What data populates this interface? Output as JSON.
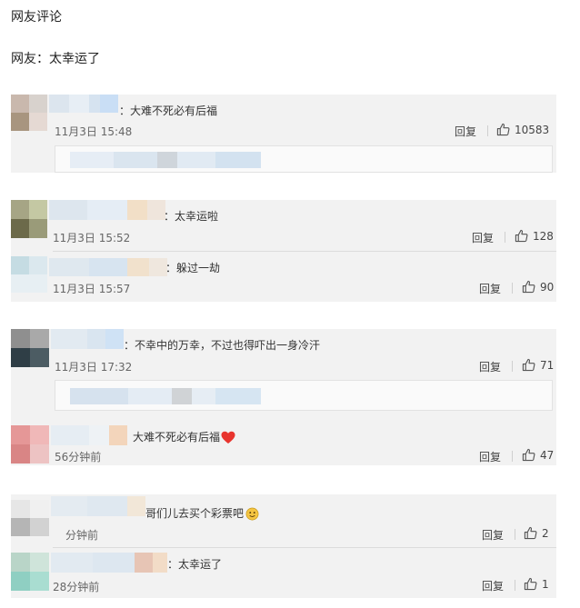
{
  "page": {
    "heading": "网友评论",
    "subheading": "网友：太幸运了"
  },
  "comments": [
    {
      "text": "：大难不死必有后福",
      "time": "11月3日 15:48",
      "reply": "回复",
      "likes": "10583"
    },
    {
      "text": "：太幸运啦",
      "time": "11月3日 15:52",
      "reply": "回复",
      "likes": "128"
    },
    {
      "text": "：躲过一劫",
      "time": "11月3日 15:57",
      "reply": "回复",
      "likes": "90"
    },
    {
      "text": "：不幸中的万幸，不过也得吓出一身冷汗",
      "time": "11月3日 17:32",
      "reply": "回复",
      "likes": "71"
    },
    {
      "text": "大难不死必有后福",
      "time": "56分钟前",
      "reply": "回复",
      "likes": "47",
      "trailing_icon": "heart-icon"
    },
    {
      "text": "哥们儿去买个彩票吧",
      "time": "分钟前",
      "reply": "回复",
      "likes": "2",
      "trailing_icon": "smile-face-icon"
    },
    {
      "text": "：太幸运了",
      "time": "28分钟前",
      "reply": "回复",
      "likes": "1"
    }
  ],
  "colors": {
    "card_bg": "#f2f2f2",
    "heart": "#e8342e",
    "emoji": "#f5c542"
  }
}
